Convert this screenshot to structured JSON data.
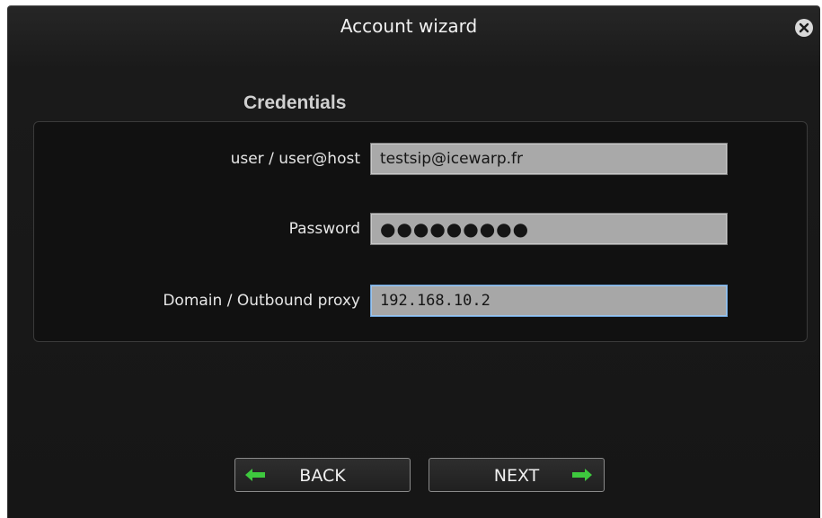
{
  "window": {
    "title": "Account wizard",
    "close_icon": "close-icon"
  },
  "credentials": {
    "section_title": "Credentials",
    "fields": [
      {
        "label": "user / user@host",
        "value": "testsip@icewarp.fr",
        "type": "text"
      },
      {
        "label": "Password",
        "value": "●●●●●●●●●",
        "type": "password"
      },
      {
        "label": "Domain / Outbound proxy",
        "value": "192.168.10.2",
        "type": "text",
        "focused": true
      }
    ]
  },
  "buttons": {
    "back_label": "BACK",
    "next_label": "NEXT",
    "back_icon": "arrow-left-icon",
    "next_icon": "arrow-right-icon"
  },
  "colors": {
    "window_bg": "#1a1a1a",
    "panel_bg": "#111111",
    "field_bg": "#a9a9a9",
    "focus_border": "#6fa3d8",
    "arrow_green": "#3ec93e"
  }
}
